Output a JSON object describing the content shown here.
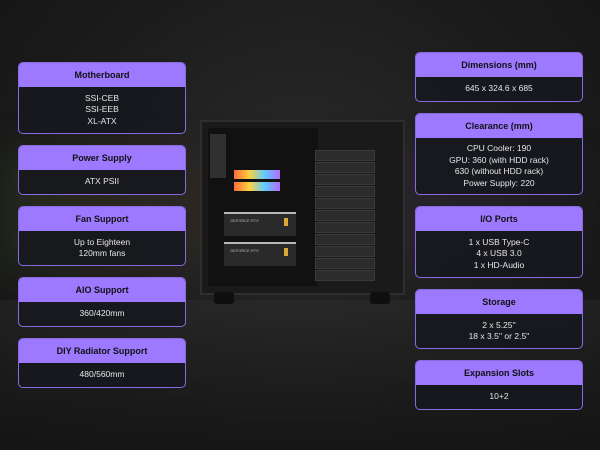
{
  "left_cards": {
    "motherboard": {
      "title": "Motherboard",
      "lines": [
        "SSI-CEB",
        "SSI-EEB",
        "XL-ATX"
      ]
    },
    "power_supply": {
      "title": "Power Supply",
      "lines": [
        "ATX PSII"
      ]
    },
    "fan_support": {
      "title": "Fan Support",
      "lines": [
        "Up to Eighteen",
        "120mm fans"
      ]
    },
    "aio_support": {
      "title": "AIO Support",
      "lines": [
        "360/420mm"
      ]
    },
    "diy_radiator": {
      "title": "DIY Radiator Support",
      "lines": [
        "480/560mm"
      ]
    }
  },
  "right_cards": {
    "dimensions": {
      "title": "Dimensions (mm)",
      "lines": [
        "645 x 324.6 x 685"
      ]
    },
    "clearance": {
      "title": "Clearance (mm)",
      "lines": [
        "CPU Cooler: 190",
        "GPU: 360 (with HDD rack)",
        "630 (without HDD rack)",
        "Power Supply: 220"
      ]
    },
    "io_ports": {
      "title": "I/O Ports",
      "lines": [
        "1 x USB Type-C",
        "4 x USB 3.0",
        "1 x HD-Audio"
      ]
    },
    "storage": {
      "title": "Storage",
      "lines": [
        "2 x 5.25''",
        "18 x 3.5'' or 2.5''"
      ]
    },
    "expansion": {
      "title": "Expansion Slots",
      "lines": [
        "10+2"
      ]
    }
  },
  "pc_image": {
    "gpu_label": "GEFORCE RTX"
  },
  "colors": {
    "accent": "#9c79ff",
    "border": "#8a6ae0",
    "card_bg": "#16181e"
  }
}
